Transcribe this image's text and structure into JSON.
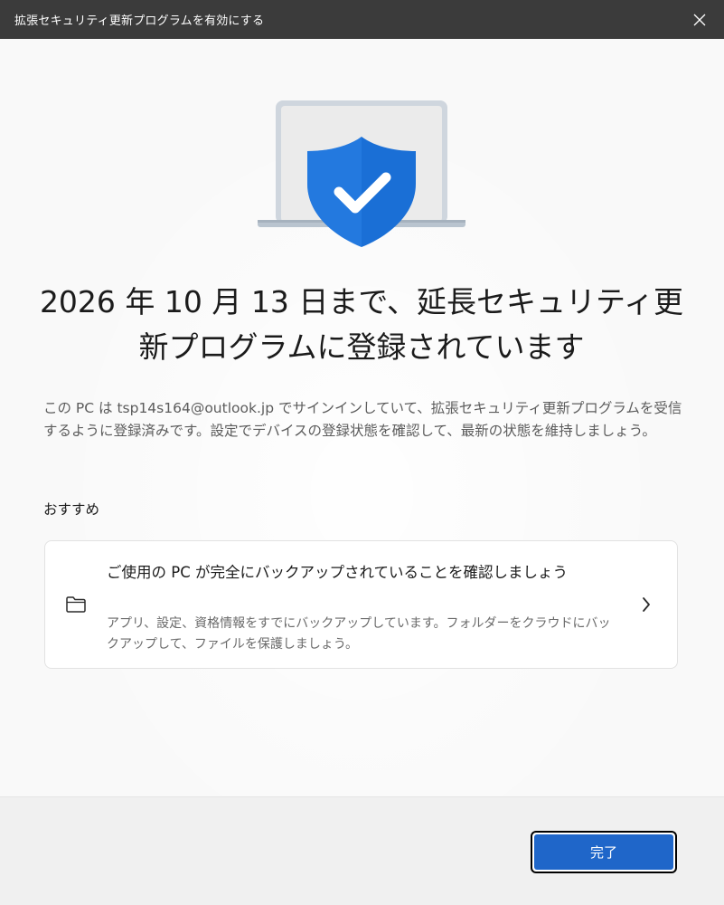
{
  "window": {
    "title": "拡張セキュリティ更新プログラムを有効にする",
    "close_icon": "close-icon"
  },
  "hero": {
    "icon": "laptop-shield-check-icon",
    "colors": {
      "shield": "#1a6fd6",
      "laptop": "#cfd6de",
      "screen": "#eaeaea"
    }
  },
  "main": {
    "headline": "2026 年 10 月 13 日まで、延長セキュリティ更新プログラムに登録されています",
    "body": "この PC は tsp14s164@outlook.jp でサインインしていて、拡張セキュリティ更新プログラムを受信するように登録済みです。設定でデバイスの登録状態を確認して、最新の状態を維持しましょう。",
    "section_label": "おすすめ"
  },
  "recommendation": {
    "icon": "folder-icon",
    "title": "ご使用の PC が完全にバックアップされていることを確認しましょう",
    "description": "アプリ、設定、資格情報をすでにバックアップしています。フォルダーをクラウドにバックアップして、ファイルを保護しましょう。",
    "chevron_icon": "chevron-right-icon"
  },
  "footer": {
    "done_label": "完了",
    "accent_color": "#1f66c9"
  }
}
